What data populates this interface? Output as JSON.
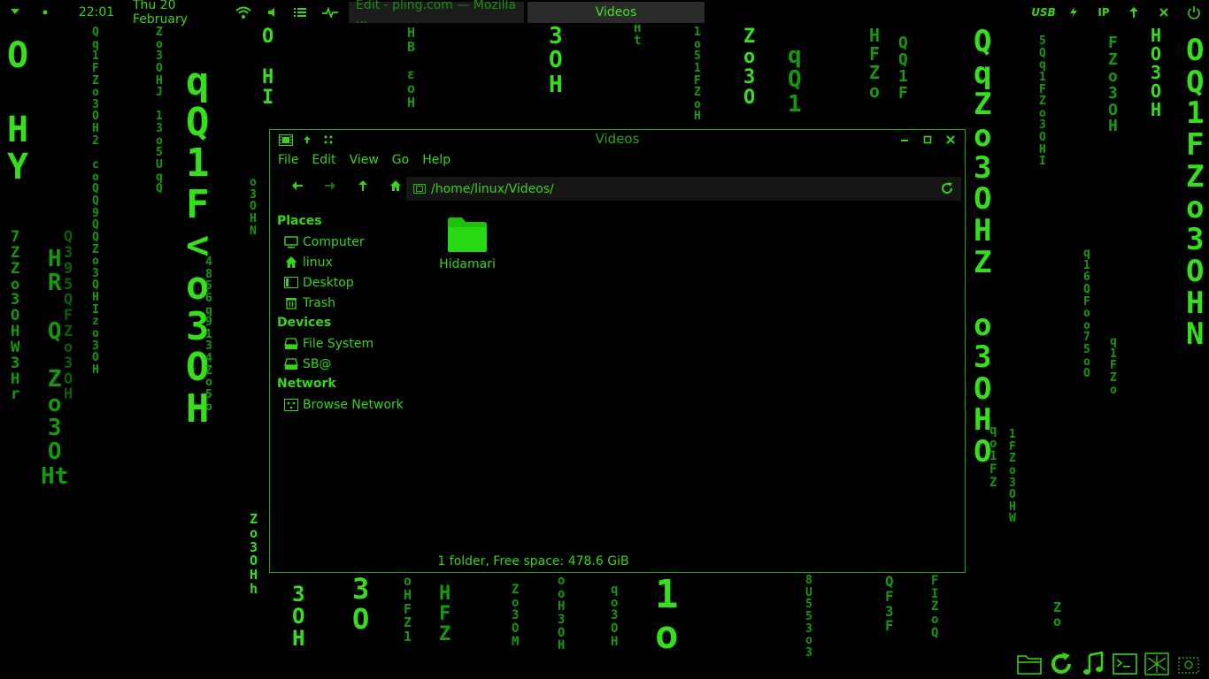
{
  "panel": {
    "time": "22:01",
    "date": "Thu 20 February",
    "tasks": [
      {
        "label": "Edit - pling.com — Mozilla ...",
        "active": false
      },
      {
        "label": "Videos",
        "active": true
      }
    ],
    "tray": {
      "usb": "USB",
      "ip": "IP"
    }
  },
  "window": {
    "title": "Videos",
    "menu": [
      "File",
      "Edit",
      "View",
      "Go",
      "Help"
    ],
    "location": "/home/linux/Videos/",
    "sidebar": {
      "places_heading": "Places",
      "places": [
        "Computer",
        "linux",
        "Desktop",
        "Trash"
      ],
      "devices_heading": "Devices",
      "devices": [
        "File System",
        "SB@"
      ],
      "network_heading": "Network",
      "network": [
        "Browse Network"
      ]
    },
    "items": [
      {
        "name": "Hidamari",
        "icon": "folder-icon"
      }
    ],
    "status": "1 folder, Free space: 478.6 GiB"
  },
  "colors": {
    "accent": "#39d416",
    "border": "#2aa114",
    "background": "#000000"
  }
}
